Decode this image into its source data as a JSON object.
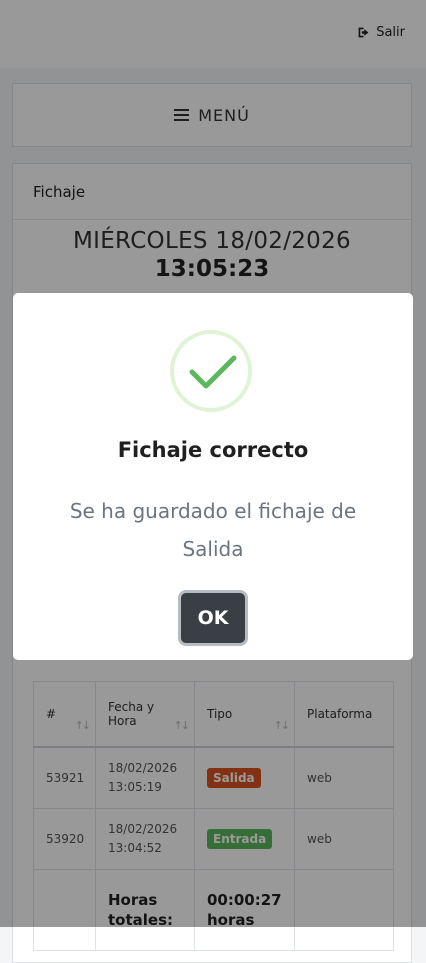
{
  "header": {
    "logout_label": "Salir"
  },
  "menu": {
    "label": "MENÚ"
  },
  "card": {
    "title": "Fichaje",
    "date": "MIÉRCOLES 18/02/2026",
    "time": "13:05:23"
  },
  "table": {
    "columns": [
      "#",
      "Fecha y Hora",
      "Tipo",
      "Plataforma"
    ],
    "rows": [
      {
        "id": "53921",
        "date": "18/02/2026",
        "time": "13:05:19",
        "type": "Salida",
        "type_color": "#d9531e",
        "platform": "web"
      },
      {
        "id": "53920",
        "date": "18/02/2026",
        "time": "13:04:52",
        "type": "Entrada",
        "type_color": "#5cb85c",
        "platform": "web"
      }
    ],
    "total": {
      "label_line1": "Horas",
      "label_line2": "totales:",
      "value_line1": "00:00:27",
      "value_line2": "horas"
    }
  },
  "modal": {
    "title": "Fichaje correcto",
    "message": "Se ha guardado el fichaje de Salida",
    "ok_label": "OK"
  },
  "colors": {
    "success": "#5cb85c",
    "danger": "#d9531e",
    "button_dark": "#3a3f45"
  }
}
